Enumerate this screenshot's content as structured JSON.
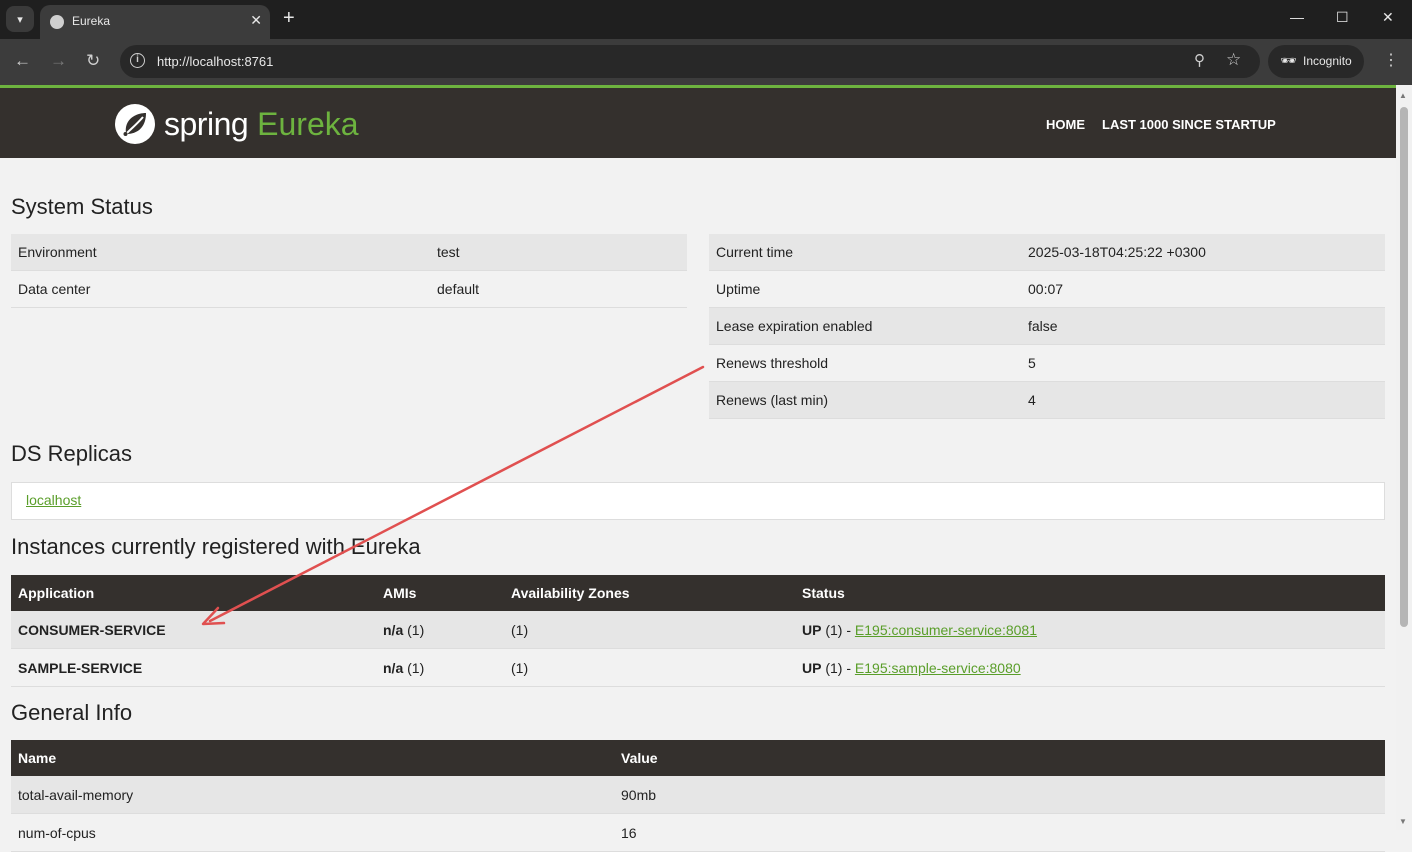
{
  "browser": {
    "tab_title": "Eureka",
    "url": "http://localhost:8761",
    "incognito_label": "Incognito"
  },
  "header": {
    "logo_spring": "spring",
    "logo_eureka": "Eureka",
    "nav_home": "HOME",
    "nav_last": "LAST 1000 SINCE STARTUP"
  },
  "system_status": {
    "title": "System Status",
    "left": [
      {
        "key": "Environment",
        "value": "test"
      },
      {
        "key": "Data center",
        "value": "default"
      }
    ],
    "right": [
      {
        "key": "Current time",
        "value": "2025-03-18T04:25:22 +0300"
      },
      {
        "key": "Uptime",
        "value": "00:07"
      },
      {
        "key": "Lease expiration enabled",
        "value": "false"
      },
      {
        "key": "Renews threshold",
        "value": "5"
      },
      {
        "key": "Renews (last min)",
        "value": "4"
      }
    ]
  },
  "ds_replicas": {
    "title": "DS Replicas",
    "link": "localhost"
  },
  "instances": {
    "title": "Instances currently registered with Eureka",
    "headers": [
      "Application",
      "AMIs",
      "Availability Zones",
      "Status"
    ],
    "rows": [
      {
        "app": "CONSUMER-SERVICE",
        "ami": "n/a",
        "ami_count": " (1)",
        "zones": "(1)",
        "status": "UP",
        "status_count": " (1) - ",
        "link": "E195:consumer-service:8081"
      },
      {
        "app": "SAMPLE-SERVICE",
        "ami": "n/a",
        "ami_count": " (1)",
        "zones": "(1)",
        "status": "UP",
        "status_count": " (1) - ",
        "link": "E195:sample-service:8080"
      }
    ]
  },
  "general_info": {
    "title": "General Info",
    "headers": [
      "Name",
      "Value"
    ],
    "rows": [
      {
        "name": "total-avail-memory",
        "value": "90mb"
      },
      {
        "name": "num-of-cpus",
        "value": "16"
      }
    ]
  },
  "colors": {
    "brand_green": "#6db33f",
    "header_dark": "#34302d",
    "annotation_arrow": "#e05050"
  }
}
